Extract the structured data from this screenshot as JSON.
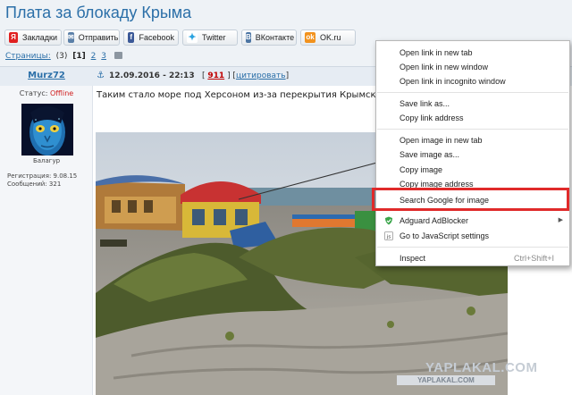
{
  "page": {
    "title": "Плата за блокаду Крыма"
  },
  "share": {
    "bookmarks": "Закладки",
    "send": "Отправить",
    "facebook": "Facebook",
    "twitter": "Twitter",
    "vkontakte": "ВКонтакте",
    "ok": "OK.ru"
  },
  "pagination": {
    "label": "Страницы:",
    "count": "(3)",
    "current": "[1]",
    "pages": [
      "2",
      "3"
    ]
  },
  "post": {
    "author": "Murz72",
    "date": "12.09.2016 - 22:13",
    "rating_open": "[",
    "rating": "911",
    "rating_close": "] [",
    "quote": "цитировать",
    "quote_close": "]",
    "status_label": "Статус:",
    "status_value": "Offline",
    "rank": "Балагур",
    "reg_line": "Регистрация: 9.08.15",
    "posts_line": "Сообщений: 321",
    "text": "Таким стало море под Херсоном из-за перекрытия Крымского к"
  },
  "watermark": {
    "main": "YAPLAKAL.COM",
    "sub": "YAPLAKAL.COM"
  },
  "context_menu": {
    "items": [
      "Open link in new tab",
      "Open link in new window",
      "Open link in incognito window",
      "Save link as...",
      "Copy link address",
      "Open image in new tab",
      "Save image as...",
      "Copy image",
      "Copy image address",
      "Search Google for image",
      "Adguard AdBlocker",
      "Go to JavaScript settings",
      "Inspect"
    ],
    "inspect_shortcut": "Ctrl+Shift+I",
    "highlighted_item": "Search Google for image",
    "highlight_color": "#e02a2a"
  },
  "colors": {
    "link": "#2b6fa8",
    "offline": "#d02020",
    "rating": "#c00000"
  }
}
